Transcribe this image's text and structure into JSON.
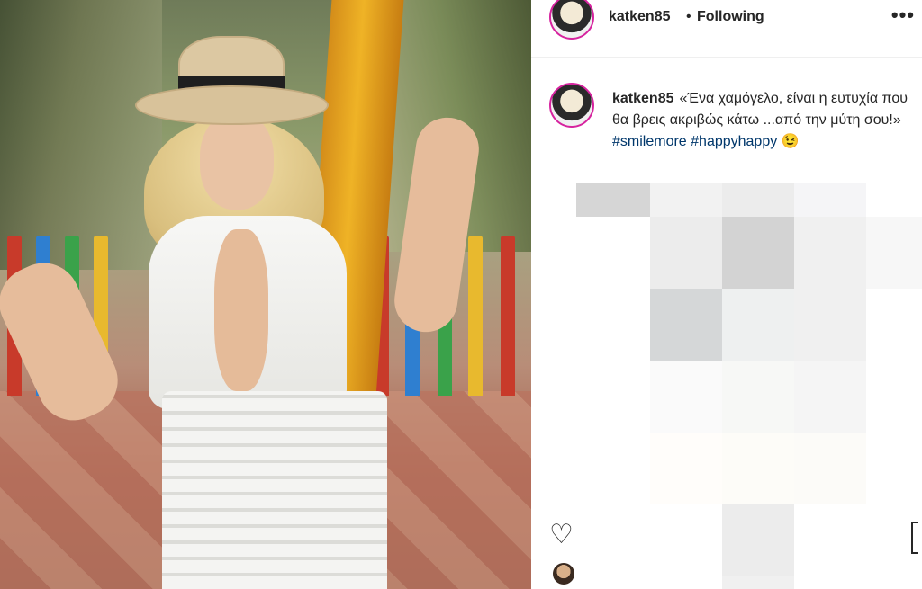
{
  "post": {
    "username": "katken85",
    "separator": "•",
    "follow_status": "Following",
    "more_label": "•••",
    "caption_text": "«Ένα χαμόγελο, είναι η ευτυχία που θα βρεις ακριβώς κάτω ...από την μύτη σου!»",
    "hashtags": [
      "#smilemore",
      "#happyhappy"
    ],
    "emoji": "😉"
  },
  "icons": {
    "heart": "heart-icon",
    "bookmark": "bookmark-icon",
    "more": "more-icon"
  },
  "colors": {
    "text": "#262626",
    "hashtag": "#00376b",
    "story_ring": "#d6249f",
    "border": "#efefef"
  },
  "pixelated_comments": [
    [
      "#d6d6d6",
      "#f2f2f2",
      "#ececec",
      "#f5f5f7",
      "#ffffff"
    ],
    [
      "#ffffff",
      "#ececec",
      "#d3d3d3",
      "#f0f0f0",
      "#f7f7f7"
    ],
    [
      "#ffffff",
      "#d5d7d8",
      "#eef0f0",
      "#f0f0f0",
      "#ffffff"
    ],
    [
      "#ffffff",
      "#fafafa",
      "#f7f8f6",
      "#f5f5f5",
      "#ffffff"
    ],
    [
      "#ffffff",
      "#fffdfa",
      "#fdfcf8",
      "#fcfbf8",
      "#ffffff"
    ],
    [
      "#ffffff",
      "#ffffff",
      "#ececec",
      "#ffffff",
      "#ffffff"
    ],
    [
      "#ffffff",
      "#ffffff",
      "#f0f0f0",
      "#ffffff",
      "#ffffff"
    ]
  ]
}
